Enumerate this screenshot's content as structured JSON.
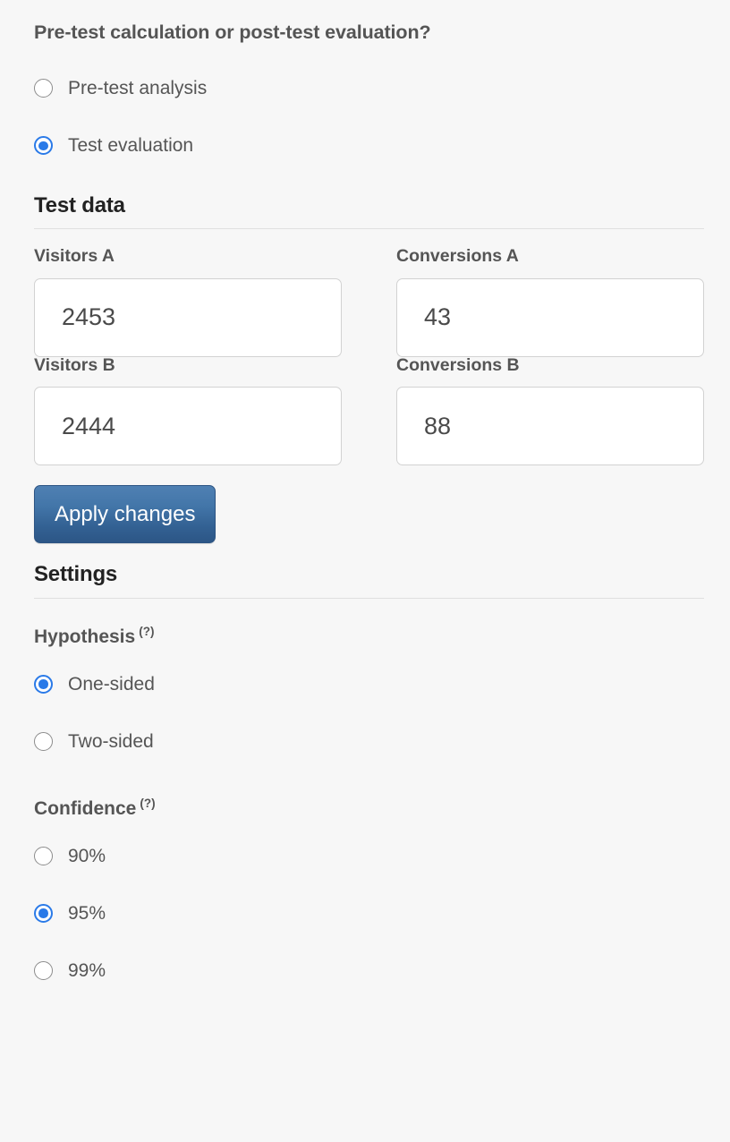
{
  "prompt": {
    "heading": "Pre-test calculation or post-test evaluation?",
    "options": [
      {
        "label": "Pre-test analysis",
        "selected": false
      },
      {
        "label": "Test evaluation",
        "selected": true
      }
    ]
  },
  "test_data": {
    "title": "Test data",
    "fields": [
      {
        "label": "Visitors A",
        "value": "2453",
        "placeholder": ""
      },
      {
        "label": "Conversions A",
        "value": "43",
        "placeholder": ""
      },
      {
        "label": "Visitors B",
        "value": "2444",
        "placeholder": ""
      },
      {
        "label": "Conversions B",
        "value": "88",
        "placeholder": ""
      }
    ],
    "apply_button": "Apply changes"
  },
  "settings": {
    "title": "Settings",
    "hypothesis": {
      "label": "Hypothesis",
      "help": "(?)",
      "options": [
        {
          "label": "One-sided",
          "selected": true
        },
        {
          "label": "Two-sided",
          "selected": false
        }
      ]
    },
    "confidence": {
      "label": "Confidence",
      "help": "(?)",
      "options": [
        {
          "label": "90%",
          "selected": false
        },
        {
          "label": "95%",
          "selected": true
        },
        {
          "label": "99%",
          "selected": false
        }
      ]
    }
  },
  "colors": {
    "accent_blue": "#2a7ae8",
    "button_blue_top": "#4f80b3",
    "button_blue_bottom": "#2c5686",
    "page_background": "#f7f7f7",
    "label_text": "#555555",
    "heading_text": "#222222"
  }
}
